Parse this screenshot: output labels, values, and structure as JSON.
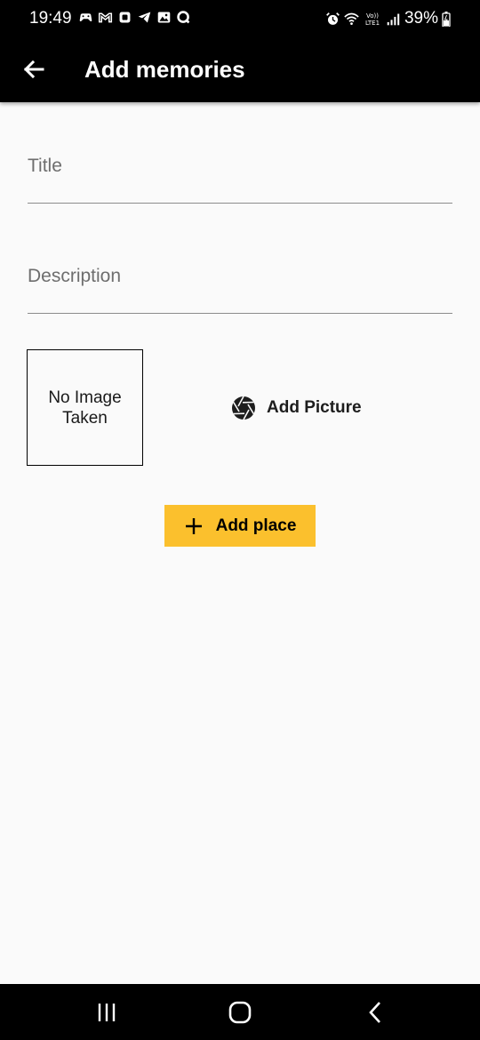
{
  "status_bar": {
    "time": "19:49",
    "battery": "39%",
    "left_icons": [
      "game-controller-icon",
      "gmail-icon",
      "notification-box-icon",
      "telegram-icon",
      "gallery-icon",
      "search-app-icon"
    ],
    "right_icons": [
      "alarm-icon",
      "wifi-icon",
      "volte-lte-icon",
      "signal-icon",
      "battery-icon"
    ]
  },
  "app_bar": {
    "title": "Add memories",
    "back_icon": "arrow-back-icon"
  },
  "form": {
    "title_placeholder": "Title",
    "title_value": "",
    "description_placeholder": "Description",
    "description_value": ""
  },
  "image_preview": {
    "empty_text": "No Image Taken"
  },
  "add_picture": {
    "label": "Add Picture",
    "icon": "camera-aperture-icon"
  },
  "add_place": {
    "label": "Add place",
    "icon": "plus-icon",
    "color": "#fbc02d"
  },
  "nav_bar": {
    "items": [
      "recent-apps-icon",
      "home-icon",
      "back-icon"
    ]
  }
}
